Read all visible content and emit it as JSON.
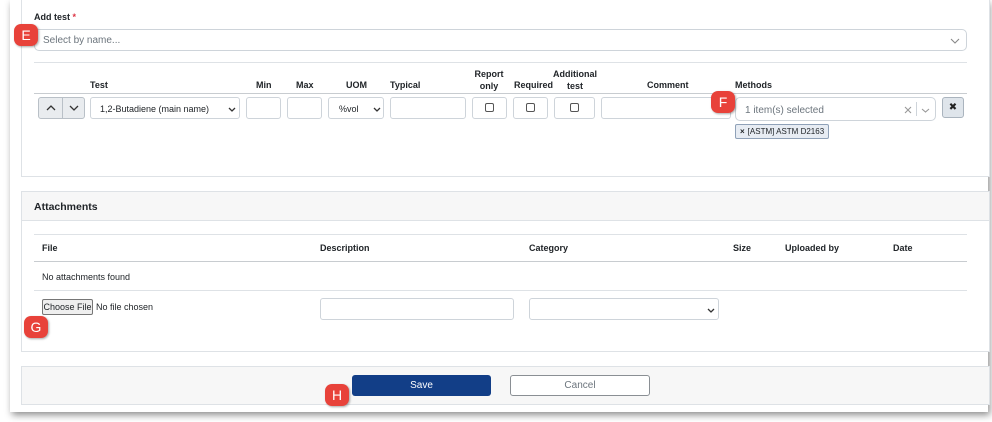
{
  "add_test": {
    "label": "Add test",
    "required_mark": "*",
    "select_placeholder": "Select by name..."
  },
  "tests_table": {
    "headers": {
      "test": "Test",
      "min": "Min",
      "max": "Max",
      "uom": "UOM",
      "typical": "Typical",
      "report_only_line1": "Report",
      "report_only_line2": "only",
      "required": "Required",
      "additional_line1": "Additional",
      "additional_line2": "test",
      "comment": "Comment",
      "methods": "Methods"
    },
    "row": {
      "test_value": "1,2-Butadiene (main name)",
      "uom_value": "%vol",
      "methods_summary": "1 item(s) selected",
      "method_chip": "[ASTM] ASTM D2163",
      "chip_remove": "×",
      "clear_mark": "×",
      "remove_row_mark": "✖"
    }
  },
  "attachments": {
    "title": "Attachments",
    "headers": {
      "file": "File",
      "description": "Description",
      "category": "Category",
      "size": "Size",
      "uploaded_by": "Uploaded by",
      "date": "Date"
    },
    "empty_text": "No attachments found",
    "choose_file_label": "Choose File",
    "no_file_text": "No file chosen"
  },
  "actions": {
    "save_label": "Save",
    "cancel_label": "Cancel"
  },
  "callouts": {
    "e": "E",
    "f": "F",
    "g": "G",
    "h": "H"
  },
  "colors": {
    "primary": "#123e87",
    "callout": "#e8423a"
  },
  "icons": {
    "move_up": "chevron-up-icon",
    "move_down": "chevron-down-icon",
    "dropdown": "chevron-down-icon",
    "clear": "close-icon",
    "remove": "close-icon"
  }
}
